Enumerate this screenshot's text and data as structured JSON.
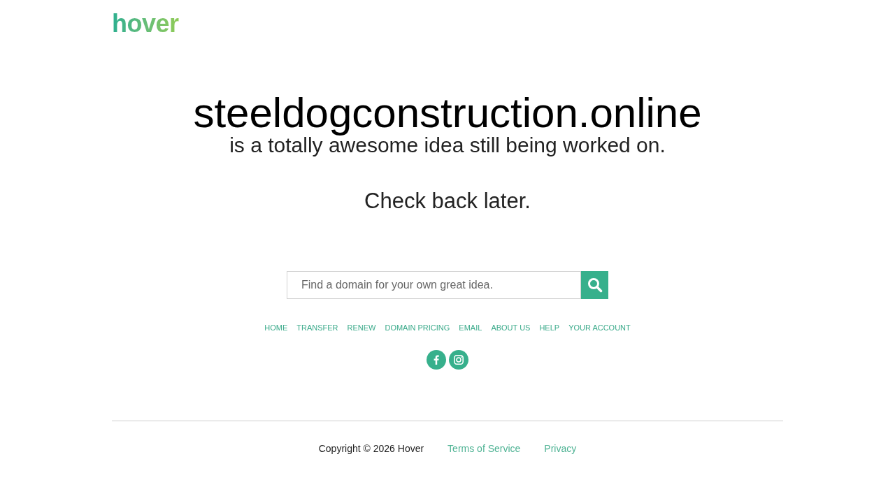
{
  "header": {
    "logo": "hover"
  },
  "hero": {
    "domain": "steeldogconstruction.online",
    "tagline": "is a totally awesome idea still being worked on.",
    "note": "Check back later."
  },
  "search": {
    "placeholder": "Find a domain for your own great idea."
  },
  "nav": [
    "HOME",
    "TRANSFER",
    "RENEW",
    "DOMAIN PRICING",
    "EMAIL",
    "ABOUT US",
    "HELP",
    "YOUR ACCOUNT"
  ],
  "social": [
    {
      "kind": "facebook"
    },
    {
      "kind": "instagram"
    }
  ],
  "footer": {
    "copyright": "Copyright © 2026 Hover",
    "links": [
      "Terms of Service",
      "Privacy"
    ]
  }
}
